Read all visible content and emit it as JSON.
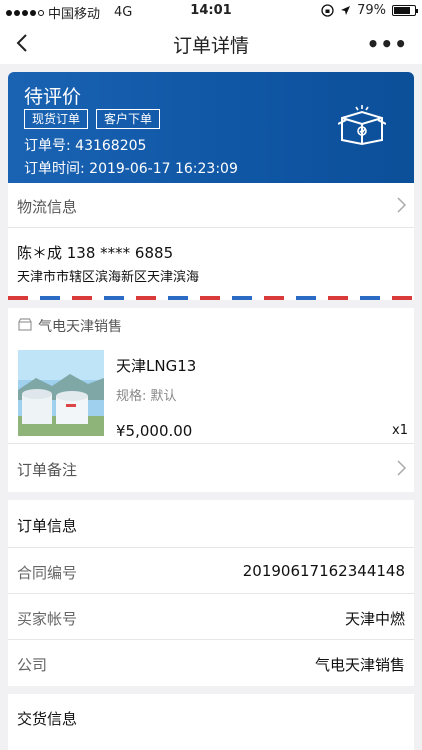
{
  "status_bar": {
    "carrier": "中国移动",
    "network": "4G",
    "time": "14:01",
    "battery": "79%",
    "battery_level": 0.79
  },
  "nav": {
    "title": "订单详情",
    "more": "•••"
  },
  "order": {
    "status": "待评价",
    "tags": [
      "现货订单",
      "客户下单"
    ],
    "order_no_label": "订单号:",
    "order_no": "43168205",
    "order_time_label": "订单时间:",
    "order_time": "2019-06-17 16:23:09"
  },
  "logistics": {
    "label": "物流信息"
  },
  "address": {
    "name_phone": "陈＊成 138 **** 6885",
    "address": "天津市市辖区滨海新区天津滨海"
  },
  "shop": {
    "name": "气电天津销售"
  },
  "product": {
    "name": "天津LNG13",
    "spec": "规格: 默认",
    "price": "¥5,000.00",
    "qty": "x1"
  },
  "remark": {
    "label": "订单备注"
  },
  "order_info": {
    "title": "订单信息",
    "rows": [
      {
        "key": "合同编号",
        "value": "20190617162344148"
      },
      {
        "key": "买家帐号",
        "value": "天津中燃"
      },
      {
        "key": "公司",
        "value": "气电天津销售"
      }
    ]
  },
  "delivery": {
    "title": "交货信息"
  },
  "colors": {
    "banner": "#1a63b3",
    "background": "#f1f1f4"
  }
}
